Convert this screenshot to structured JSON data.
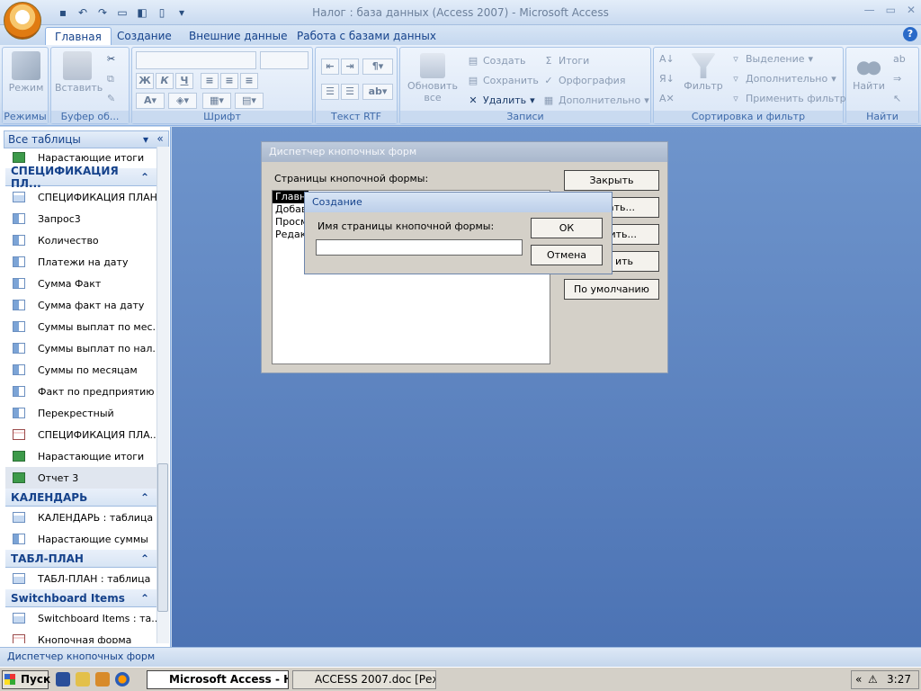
{
  "window": {
    "title": "Налог : база данных (Access 2007) - Microsoft Access"
  },
  "tabs": [
    {
      "label": "Главная",
      "active": true
    },
    {
      "label": "Создание",
      "active": false
    },
    {
      "label": "Внешние данные",
      "active": false
    },
    {
      "label": "Работа с базами данных",
      "active": false
    }
  ],
  "ribbon": {
    "groups": {
      "views": "Режимы",
      "clipboard": "Буфер об...",
      "font": "Шрифт",
      "rtf": "Текст RTF",
      "records": "Записи",
      "sort_filter": "Сортировка и фильтр",
      "find": "Найти"
    },
    "view_button": "Режим",
    "paste_button": "Вставить",
    "refresh_button": "Обновить все",
    "records": {
      "create": "Создать",
      "save": "Сохранить",
      "delete": "Удалить",
      "totals": "Итоги",
      "spelling": "Орфография",
      "more": "Дополнительно"
    },
    "filter_button": "Фильтр",
    "sort_filter": {
      "selection": "Выделение",
      "advanced": "Дополнительно",
      "apply": "Применить фильтр"
    },
    "find_button": "Найти",
    "font_buttons": {
      "bold": "Ж",
      "italic": "К",
      "underline": "Ч"
    }
  },
  "nav": {
    "header": "Все таблицы",
    "items": [
      {
        "type": "item",
        "icon": "report",
        "label": "Нарастающие итоги"
      },
      {
        "type": "group",
        "label": "СПЕЦИФИКАЦИЯ ПЛ..."
      },
      {
        "type": "item",
        "icon": "table",
        "label": "СПЕЦИФИКАЦИЯ ПЛАН..."
      },
      {
        "type": "item",
        "icon": "query",
        "label": "Запрос3"
      },
      {
        "type": "item",
        "icon": "query",
        "label": "Количество"
      },
      {
        "type": "item",
        "icon": "query",
        "label": "Платежи на дату"
      },
      {
        "type": "item",
        "icon": "query",
        "label": "Сумма Факт"
      },
      {
        "type": "item",
        "icon": "query",
        "label": "Сумма факт на дату"
      },
      {
        "type": "item",
        "icon": "query",
        "label": "Суммы выплат по мес..."
      },
      {
        "type": "item",
        "icon": "query",
        "label": "Суммы выплат по нал..."
      },
      {
        "type": "item",
        "icon": "query",
        "label": "Суммы по месяцам"
      },
      {
        "type": "item",
        "icon": "query",
        "label": "Факт по предприятию"
      },
      {
        "type": "item",
        "icon": "query",
        "label": "Перекрестный"
      },
      {
        "type": "item",
        "icon": "form",
        "label": "СПЕЦИФИКАЦИЯ ПЛА..."
      },
      {
        "type": "item",
        "icon": "report",
        "label": "Нарастающие итоги"
      },
      {
        "type": "item",
        "icon": "report",
        "label": "Отчет 3",
        "selected": true
      },
      {
        "type": "group",
        "label": "КАЛЕНДАРЬ"
      },
      {
        "type": "item",
        "icon": "table",
        "label": "КАЛЕНДАРЬ : таблица"
      },
      {
        "type": "item",
        "icon": "query",
        "label": "Нарастающие суммы"
      },
      {
        "type": "group",
        "label": "ТАБЛ-ПЛАН"
      },
      {
        "type": "item",
        "icon": "table",
        "label": "ТАБЛ-ПЛАН : таблица"
      },
      {
        "type": "group",
        "label": "Switchboard Items"
      },
      {
        "type": "item",
        "icon": "table",
        "label": "Switchboard Items : та..."
      },
      {
        "type": "item",
        "icon": "form",
        "label": "Кнопочная форма"
      }
    ]
  },
  "switchboard_dialog": {
    "title": "Диспетчер кнопочных форм",
    "pages_label": "Страницы кнопочной формы:",
    "pages": [
      "Главна",
      "Добав",
      "Просмо",
      "Редакт"
    ],
    "buttons": {
      "close": "Закрыть",
      "create": "ать...",
      "edit": "нить...",
      "delete": "ить",
      "default": "По умолчанию"
    }
  },
  "create_dialog": {
    "title": "Создание",
    "name_label": "Имя страницы кнопочной формы:",
    "name_value": "",
    "ok": "ОК",
    "cancel": "Отмена"
  },
  "status": {
    "text": "Диспетчер кнопочных форм"
  },
  "taskbar": {
    "start": "Пуск",
    "apps": [
      {
        "label": "Microsoft Access - На...",
        "active": true
      },
      {
        "label": "ACCESS 2007.doc [Режи...",
        "active": false
      }
    ],
    "clock": "3:27"
  }
}
